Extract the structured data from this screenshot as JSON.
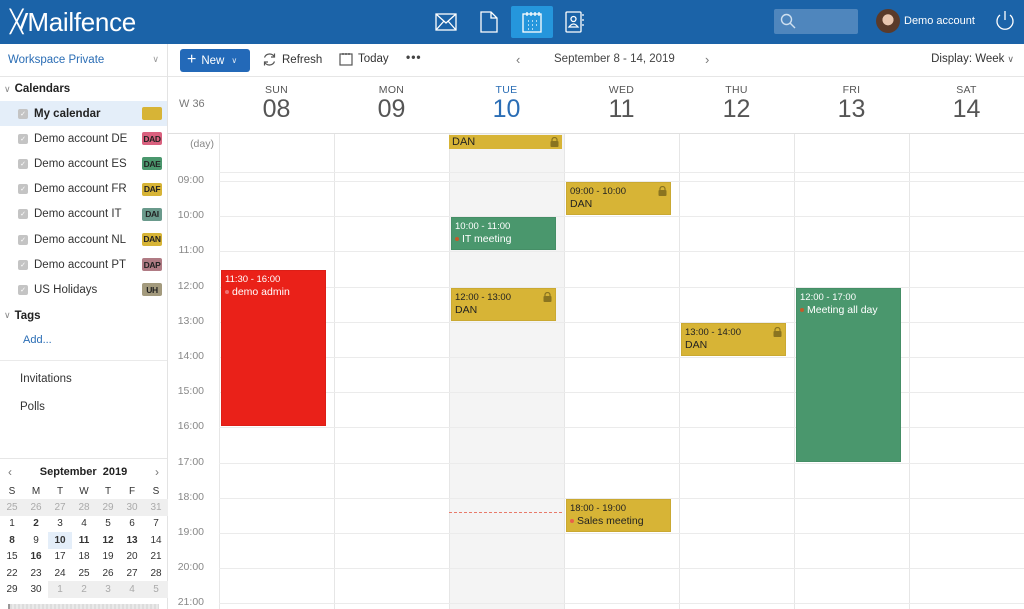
{
  "app": {
    "brand": "Mailfence",
    "apps": [
      {
        "id": "mail",
        "icon": "envelope-icon",
        "active": false
      },
      {
        "id": "documents",
        "icon": "document-icon",
        "active": false
      },
      {
        "id": "calendar",
        "icon": "calendar-icon",
        "active": true
      },
      {
        "id": "contacts",
        "icon": "contacts-icon",
        "active": false
      }
    ],
    "search_placeholder": "",
    "account_name": "Demo account"
  },
  "sidebar": {
    "workspace": "Workspace Private",
    "calendars_heading": "Calendars",
    "calendars": [
      {
        "label": "My calendar",
        "badge": "",
        "color": "#d7b436",
        "selected": true
      },
      {
        "label": "Demo account DE",
        "badge": "DAD",
        "color": "#d9607e",
        "selected": false
      },
      {
        "label": "Demo account ES",
        "badge": "DAE",
        "color": "#4a976d",
        "selected": false
      },
      {
        "label": "Demo account FR",
        "badge": "DAF",
        "color": "#d7b436",
        "selected": false
      },
      {
        "label": "Demo account IT",
        "badge": "DAI",
        "color": "#6a9a8c",
        "selected": false
      },
      {
        "label": "Demo account NL",
        "badge": "DAN",
        "color": "#d7b436",
        "selected": false
      },
      {
        "label": "Demo account PT",
        "badge": "DAP",
        "color": "#b07b84",
        "selected": false
      },
      {
        "label": "US Holidays",
        "badge": "UH",
        "color": "#a39a7d",
        "selected": false
      }
    ],
    "tags_heading": "Tags",
    "tags_add": "Add...",
    "links": [
      "Invitations",
      "Polls"
    ],
    "minical": {
      "title": "September  2019",
      "dow": [
        "S",
        "M",
        "T",
        "W",
        "T",
        "F",
        "S"
      ],
      "weeks": [
        [
          {
            "d": "25",
            "o": true
          },
          {
            "d": "26",
            "o": true
          },
          {
            "d": "27",
            "o": true
          },
          {
            "d": "28",
            "o": true
          },
          {
            "d": "29",
            "o": true
          },
          {
            "d": "30",
            "o": true
          },
          {
            "d": "31",
            "o": true
          }
        ],
        [
          {
            "d": "1"
          },
          {
            "d": "2",
            "b": true
          },
          {
            "d": "3"
          },
          {
            "d": "4"
          },
          {
            "d": "5"
          },
          {
            "d": "6"
          },
          {
            "d": "7"
          }
        ],
        [
          {
            "d": "8",
            "b": true
          },
          {
            "d": "9"
          },
          {
            "d": "10",
            "t": true
          },
          {
            "d": "11",
            "b": true
          },
          {
            "d": "12",
            "b": true
          },
          {
            "d": "13",
            "b": true
          },
          {
            "d": "14"
          }
        ],
        [
          {
            "d": "15"
          },
          {
            "d": "16",
            "b": true
          },
          {
            "d": "17"
          },
          {
            "d": "18"
          },
          {
            "d": "19"
          },
          {
            "d": "20"
          },
          {
            "d": "21"
          }
        ],
        [
          {
            "d": "22"
          },
          {
            "d": "23"
          },
          {
            "d": "24"
          },
          {
            "d": "25"
          },
          {
            "d": "26"
          },
          {
            "d": "27"
          },
          {
            "d": "28"
          }
        ],
        [
          {
            "d": "29"
          },
          {
            "d": "30"
          },
          {
            "d": "1",
            "o": true
          },
          {
            "d": "2",
            "o": true
          },
          {
            "d": "3",
            "o": true
          },
          {
            "d": "4",
            "o": true
          },
          {
            "d": "5",
            "o": true
          }
        ]
      ]
    }
  },
  "toolbar": {
    "new_label": "New",
    "refresh_label": "Refresh",
    "today_label": "Today",
    "more_label": "•••",
    "range_label": "September 8 - 14, 2019",
    "display_label": "Display: Week"
  },
  "calendar": {
    "week_label": "W 36",
    "allday_label": "(day)",
    "days": [
      {
        "name": "SUN",
        "date": "08",
        "today": false
      },
      {
        "name": "MON",
        "date": "09",
        "today": false
      },
      {
        "name": "TUE",
        "date": "10",
        "today": true
      },
      {
        "name": "WED",
        "date": "11",
        "today": false
      },
      {
        "name": "THU",
        "date": "12",
        "today": false
      },
      {
        "name": "FRI",
        "date": "13",
        "today": false
      },
      {
        "name": "SAT",
        "date": "14",
        "today": false
      }
    ],
    "hours": [
      "09:00",
      "10:00",
      "11:00",
      "12:00",
      "13:00",
      "14:00",
      "15:00",
      "16:00",
      "17:00",
      "18:00",
      "19:00",
      "20:00",
      "21:00"
    ],
    "first_hour": 9,
    "now_time": 18.4,
    "allday_events": [
      {
        "day": 2,
        "title": "DAN",
        "color": "yellow",
        "locked": true
      }
    ],
    "events": [
      {
        "day": 0,
        "start": 11.5,
        "end": 16,
        "time": "11:30 - 16:00",
        "title": "demo admin",
        "color": "red",
        "bullet": "#f07070",
        "locked": false
      },
      {
        "day": 2,
        "start": 10,
        "end": 11,
        "time": "10:00 - 11:00",
        "title": "IT meeting",
        "color": "green",
        "bullet": "#c45a2a",
        "locked": false
      },
      {
        "day": 2,
        "start": 12,
        "end": 13,
        "time": "12:00 - 13:00",
        "title": "DAN",
        "color": "yellow",
        "locked": true
      },
      {
        "day": 3,
        "start": 9,
        "end": 10,
        "time": "09:00 - 10:00",
        "title": "DAN",
        "color": "yellow",
        "locked": true
      },
      {
        "day": 3,
        "start": 18,
        "end": 19,
        "time": "18:00 - 19:00",
        "title": "Sales meeting",
        "color": "yellow",
        "bullet": "#e8604a",
        "locked": false
      },
      {
        "day": 4,
        "start": 13,
        "end": 14,
        "time": "13:00 - 14:00",
        "title": "DAN",
        "color": "yellow",
        "locked": true
      },
      {
        "day": 5,
        "start": 12,
        "end": 17,
        "time": "12:00 - 17:00",
        "title": "Meeting all day",
        "color": "green",
        "bullet": "#c45a2a",
        "locked": false
      }
    ]
  }
}
